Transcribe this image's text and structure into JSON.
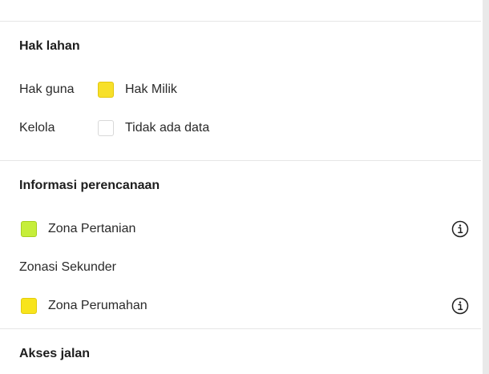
{
  "land_rights": {
    "title": "Hak lahan",
    "rows": [
      {
        "label": "Hak guna",
        "value": "Hak Milik",
        "color": "#f7e02a"
      },
      {
        "label": "Kelola",
        "value": "Tidak ada data",
        "color": "#ffffff"
      }
    ]
  },
  "planning": {
    "title": "Informasi perencanaan",
    "primary_zone": {
      "label": "Zona Pertanian",
      "color": "#c6ee3a",
      "icon": "info-icon"
    },
    "secondary_heading": "Zonasi Sekunder",
    "secondary_zone": {
      "label": "Zona Perumahan",
      "color": "#f8e41c",
      "icon": "info-icon"
    }
  },
  "road_access": {
    "title": "Akses jalan"
  }
}
